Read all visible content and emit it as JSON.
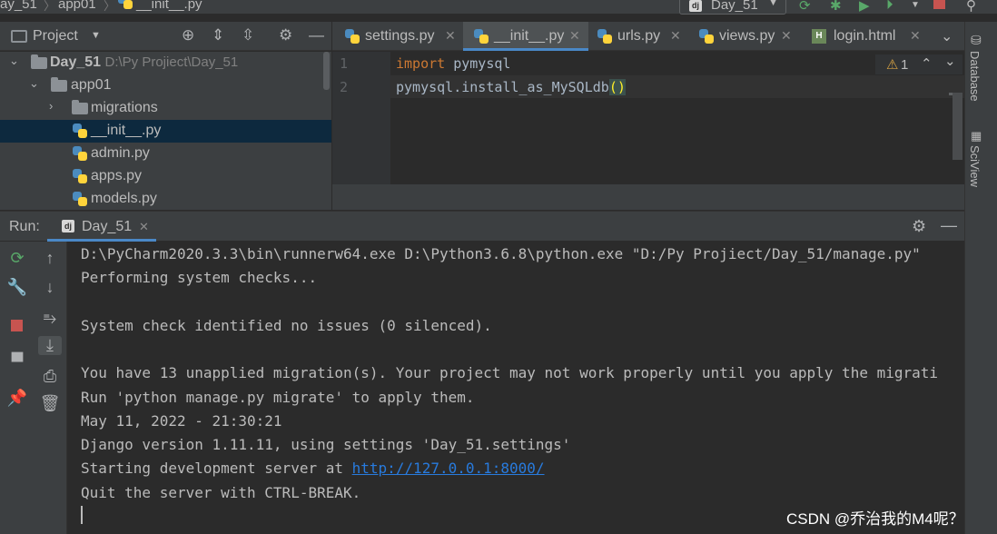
{
  "navbar": {
    "crumbs": [
      "ay_51",
      "app01",
      "__init__.py"
    ],
    "run_config": "Day_51"
  },
  "project": {
    "title": "Project",
    "tree": [
      {
        "label": "Day_51",
        "path": "D:\\Py Projiect\\Day_51"
      },
      {
        "label": "app01"
      },
      {
        "label": "migrations"
      },
      {
        "label": "__init__.py"
      },
      {
        "label": "admin.py"
      },
      {
        "label": "apps.py"
      },
      {
        "label": "models.py"
      }
    ]
  },
  "editor": {
    "tabs": [
      {
        "label": "settings.py"
      },
      {
        "label": "__init__.py"
      },
      {
        "label": "urls.py"
      },
      {
        "label": "views.py"
      },
      {
        "label": "login.html"
      }
    ],
    "lines": [
      {
        "num": "1",
        "kw": "import",
        "rest": " pymysql"
      },
      {
        "num": "2",
        "text": "pymysql.install_as_MySQLdb",
        "paren": "()"
      }
    ],
    "warnings": "1"
  },
  "sidebar_right": {
    "database": "Database",
    "sciview": "SciView"
  },
  "run": {
    "label": "Run:",
    "tab": "Day_51",
    "console": [
      "D:\\PyCharm2020.3.3\\bin\\runnerw64.exe D:\\Python3.6.8\\python.exe \"D:/Py Projiect/Day_51/manage.py\"",
      "Performing system checks...",
      "",
      "System check identified no issues (0 silenced).",
      "",
      "You have 13 unapplied migration(s). Your project may not work properly until you apply the migrati",
      "Run 'python manage.py migrate' to apply them.",
      "May 11, 2022 - 21:30:21",
      "Django version 1.11.11, using settings 'Day_51.settings'",
      "Starting development server at ",
      "Quit the server with CTRL-BREAK."
    ],
    "server_url": "http://127.0.0.1:8000/"
  },
  "watermark": "CSDN @乔治我的M4呢？",
  "colors": {
    "accent": "#4a88c7",
    "keyword": "#cc7832",
    "link": "#287bde",
    "stop": "#c75450",
    "run": "#59a869"
  }
}
